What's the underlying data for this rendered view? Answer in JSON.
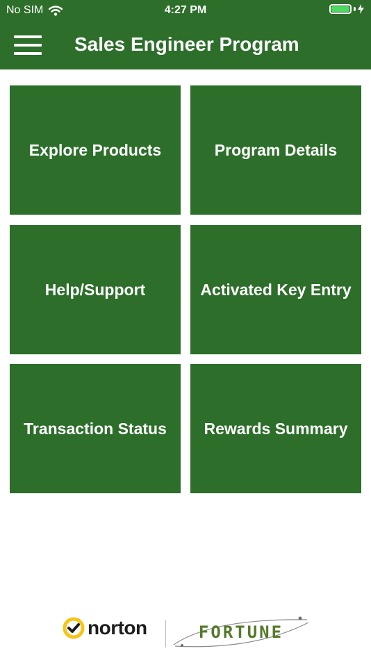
{
  "status_bar": {
    "carrier": "No SIM",
    "time": "4:27 PM",
    "battery_color": "#4cd964"
  },
  "header": {
    "title": "Sales Engineer Program",
    "menu_icon": "hamburger-menu-icon",
    "background": "#2c6e2a"
  },
  "tiles": [
    {
      "label": "Explore Products"
    },
    {
      "label": "Program Details"
    },
    {
      "label": "Help/Support"
    },
    {
      "label": "Activated Key Entry"
    },
    {
      "label": "Transaction Status"
    },
    {
      "label": "Rewards Summary"
    }
  ],
  "footer": {
    "norton_logo_text": "norton",
    "fortune_logo_text": "FORTUNE"
  }
}
